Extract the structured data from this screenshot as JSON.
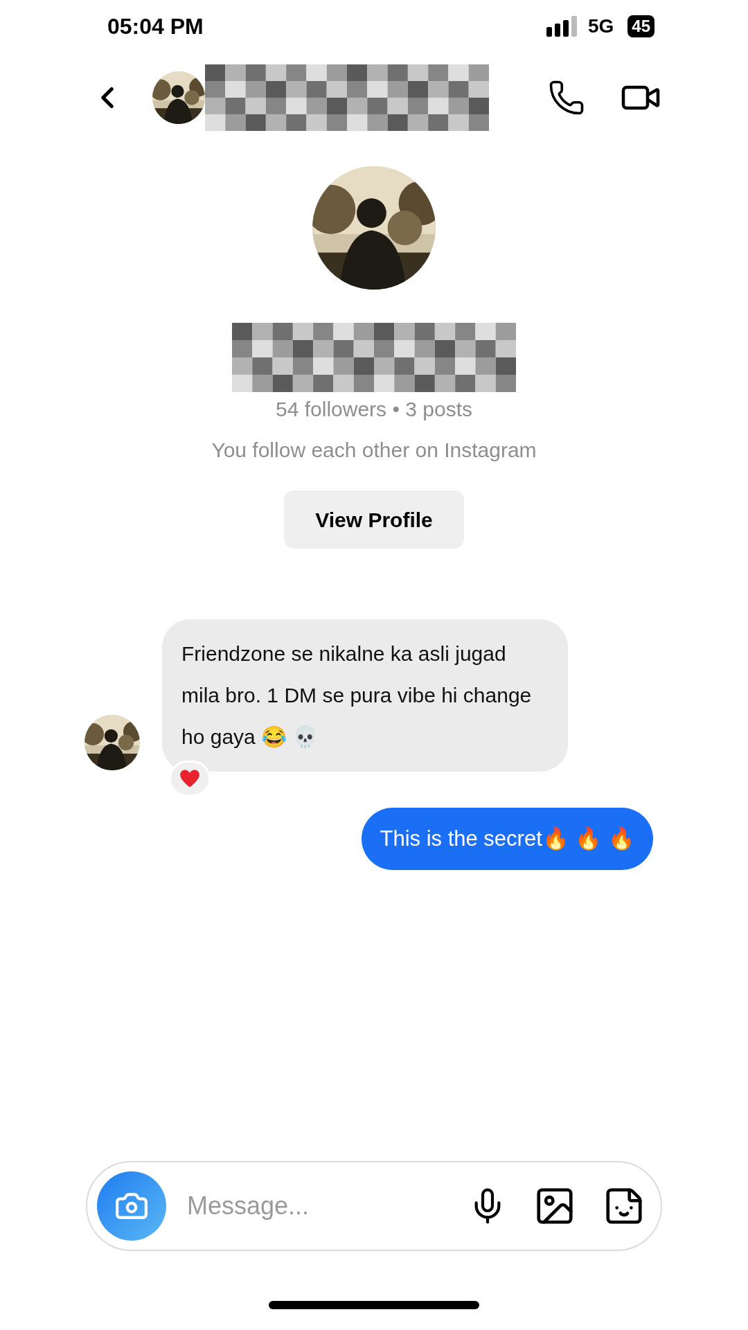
{
  "status_bar": {
    "time": "05:04 PM",
    "network": "5G",
    "battery": "45"
  },
  "header": {
    "name_redacted": true
  },
  "profile": {
    "name_redacted": true,
    "stats": "54 followers • 3 posts",
    "mutual": "You follow each other on Instagram",
    "button": "View Profile"
  },
  "messages": [
    {
      "kind": "received",
      "text": "Friendzone se nikalne ka asli jugad mila bro. 1 DM se pura vibe hi change ho gaya 😂 💀",
      "reacted": true
    },
    {
      "kind": "sent",
      "text": "This is the secret🔥 🔥 🔥",
      "reacted": false
    }
  ],
  "composer": {
    "placeholder": "Message..."
  }
}
